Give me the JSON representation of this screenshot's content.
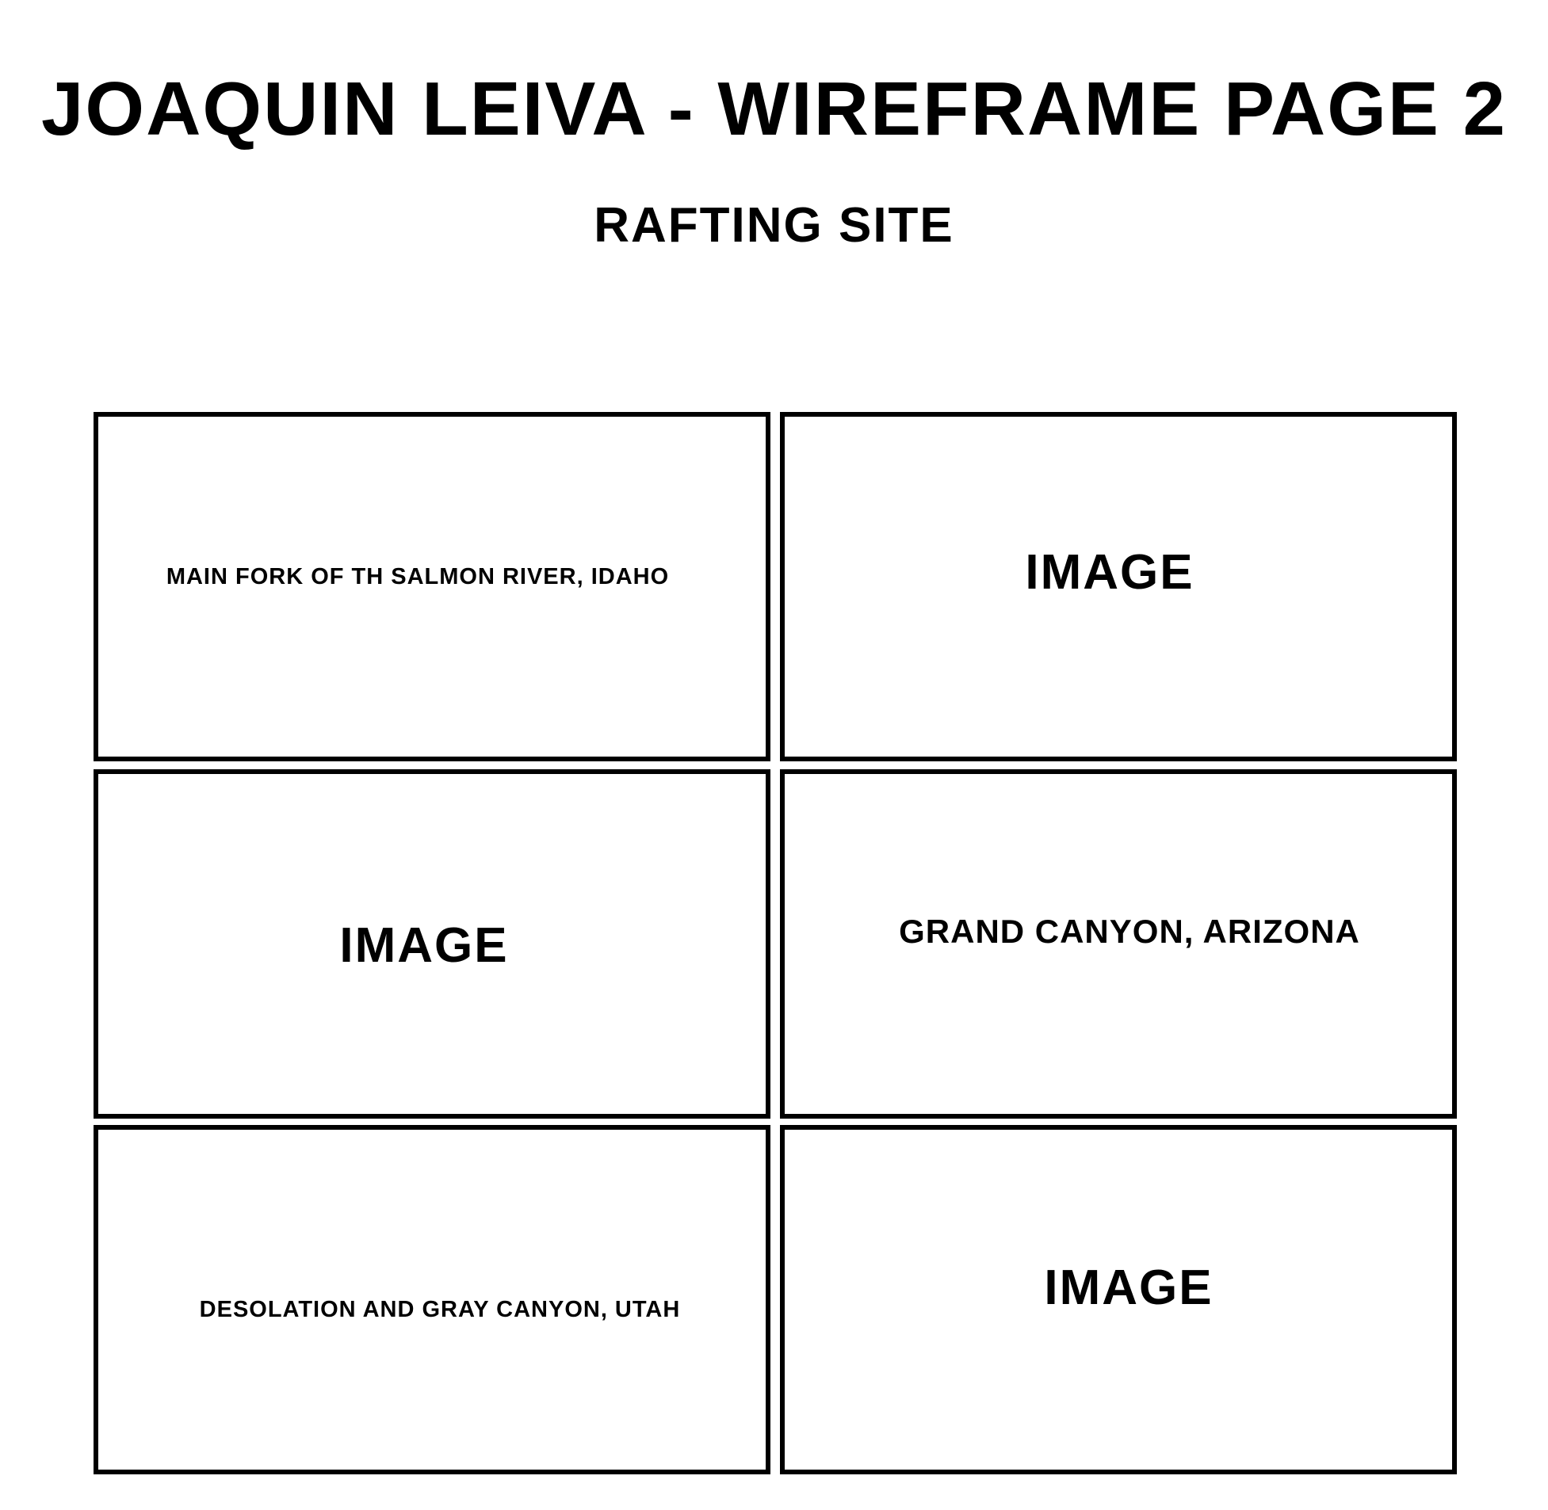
{
  "header": {
    "title": "JOAQUIN LEIVA - WIREFRAME PAGE 2",
    "subtitle": "RAFTING SITE"
  },
  "grid": {
    "cells": [
      {
        "label": "MAIN FORK OF TH SALMON RIVER, IDAHO"
      },
      {
        "label": "IMAGE"
      },
      {
        "label": "IMAGE"
      },
      {
        "label": "GRAND CANYON, ARIZONA"
      },
      {
        "label": "DESOLATION AND GRAY CANYON, UTAH"
      },
      {
        "label": "IMAGE"
      }
    ]
  }
}
